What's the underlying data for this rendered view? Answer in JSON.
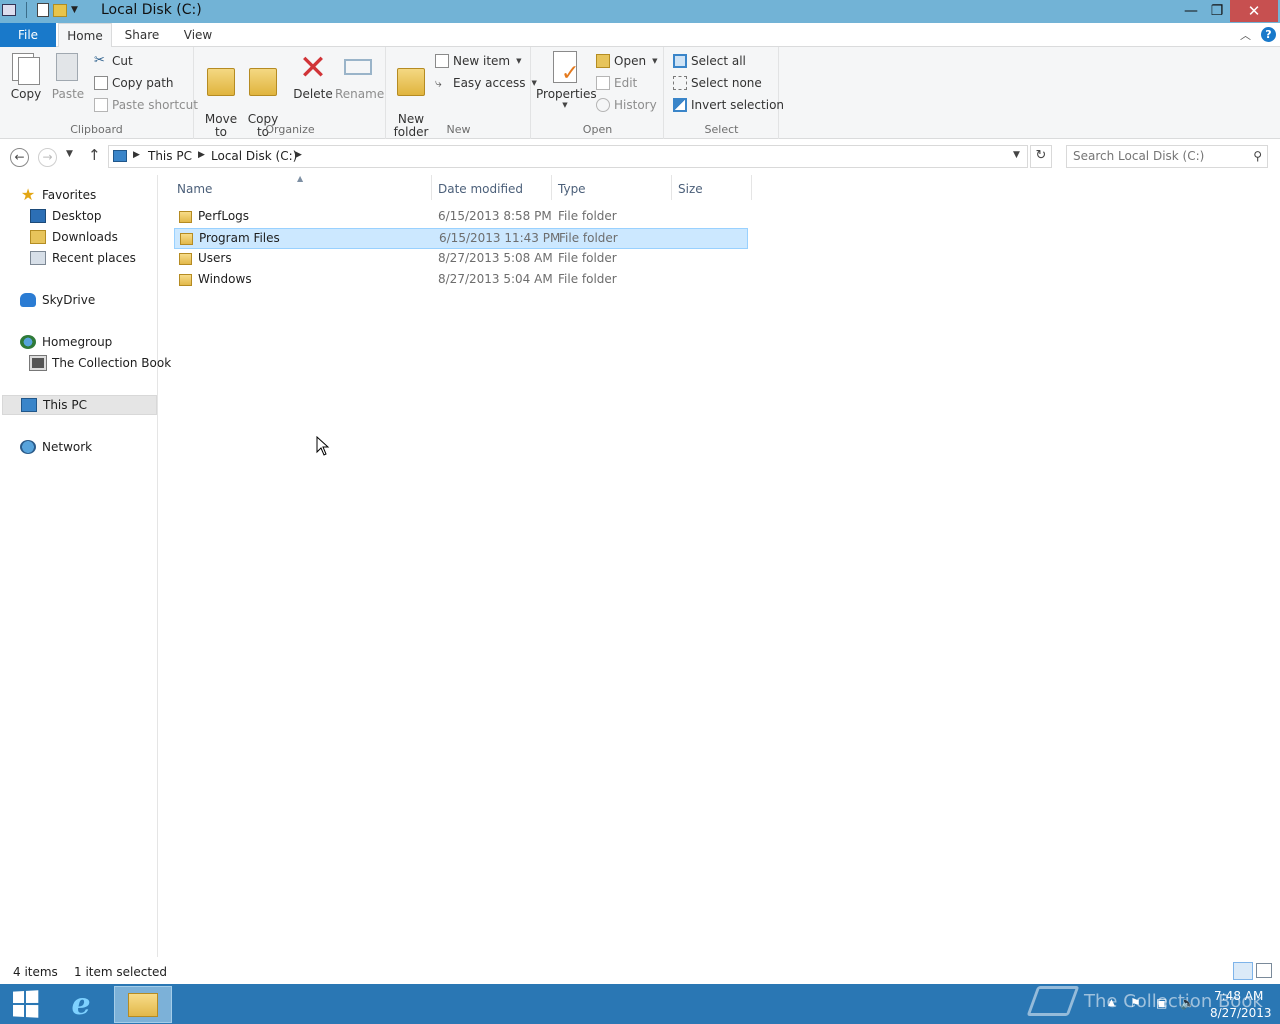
{
  "window": {
    "title": "Local Disk (C:)",
    "minimize": "—",
    "maximize": "❐",
    "close": "✕"
  },
  "ribbon_tabs": [
    "File",
    "Home",
    "Share",
    "View"
  ],
  "ribbon": {
    "help": "?",
    "clipboard": {
      "label": "Clipboard",
      "copy": "Copy",
      "paste": "Paste",
      "cut": "Cut",
      "copy_path": "Copy path",
      "paste_shortcut": "Paste shortcut"
    },
    "organize": {
      "label": "Organize",
      "move_to": "Move\nto",
      "copy_to": "Copy\nto",
      "delete": "Delete",
      "rename": "Rename"
    },
    "new": {
      "label": "New",
      "new_folder": "New\nfolder",
      "new_item": "New item",
      "easy_access": "Easy access"
    },
    "open": {
      "label": "Open",
      "properties": "Properties",
      "open": "Open",
      "edit": "Edit",
      "history": "History"
    },
    "select": {
      "label": "Select",
      "select_all": "Select all",
      "select_none": "Select none",
      "invert_selection": "Invert selection"
    }
  },
  "address": {
    "crumbs": [
      "This PC",
      "Local Disk (C:)"
    ],
    "search_placeholder": "Search Local Disk (C:)"
  },
  "nav_pane": {
    "favorites": "Favorites",
    "favorites_items": [
      "Desktop",
      "Downloads",
      "Recent places"
    ],
    "skydrive": "SkyDrive",
    "homegroup": "Homegroup",
    "homegroup_items": [
      "The Collection Book"
    ],
    "this_pc": "This PC",
    "network": "Network"
  },
  "columns": {
    "name": "Name",
    "date_modified": "Date modified",
    "type": "Type",
    "size": "Size"
  },
  "files": [
    {
      "name": "PerfLogs",
      "date": "6/15/2013 8:58 PM",
      "type": "File folder",
      "size": "",
      "selected": false
    },
    {
      "name": "Program Files",
      "date": "6/15/2013 11:43 PM",
      "type": "File folder",
      "size": "",
      "selected": true
    },
    {
      "name": "Users",
      "date": "8/27/2013 5:08 AM",
      "type": "File folder",
      "size": "",
      "selected": false
    },
    {
      "name": "Windows",
      "date": "8/27/2013 5:04 AM",
      "type": "File folder",
      "size": "",
      "selected": false
    }
  ],
  "status": {
    "item_count": "4 items",
    "selected_count": "1 item selected"
  },
  "taskbar": {
    "watermark": "The Collection Book",
    "time": "7:48 AM",
    "date": "8/27/2013"
  },
  "colors": {
    "titlebar": "#72b3d6",
    "file_tab": "#1979ca",
    "selection": "#cce8ff",
    "taskbar": "#2a77b4",
    "close_button": "#c75050"
  }
}
